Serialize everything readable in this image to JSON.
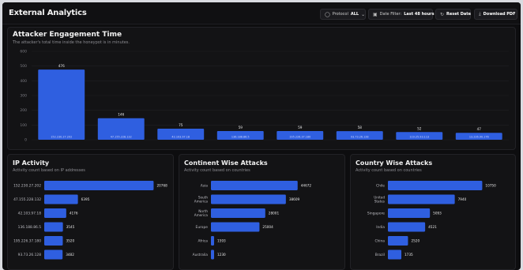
{
  "header": {
    "title": "External Analytics",
    "protocol": {
      "label": "Protocol",
      "value": "ALL"
    },
    "date_filter": {
      "label": "Date Filter:",
      "value": "Last 48 hours"
    },
    "reset_label": "Reset Date",
    "download_label": "Download PDF"
  },
  "engagement": {
    "title": "Attacker Engagement Time",
    "subtitle": "The attacker's total time inside the honeypot is in minutes."
  },
  "ip_activity": {
    "title": "IP Activity",
    "subtitle": "Activity count based on IP addresses"
  },
  "continent": {
    "title": "Continent Wise Attacks",
    "subtitle": "Activity count based on countries"
  },
  "country": {
    "title": "Country Wise Attacks",
    "subtitle": "Activity count based on countries"
  },
  "colors": {
    "bar": "#2f5fe0",
    "background": "#0d0d0f",
    "panel": "#131315"
  },
  "chart_data": [
    {
      "id": "engagement",
      "type": "bar",
      "categories": [
        "152.230.27.202",
        "47.155.228.132",
        "42.103.97.18",
        "136.188.86.5",
        "195.226.37.180",
        "93.73.26.128",
        "119.25.93.113",
        "13.226.90.176"
      ],
      "values": [
        476,
        146,
        75,
        59,
        59,
        58,
        52,
        47
      ],
      "ylim": [
        0,
        600
      ],
      "yticks": [
        0,
        100,
        200,
        300,
        400,
        500,
        600
      ],
      "grid": true
    },
    {
      "id": "ip_activity",
      "type": "bar",
      "orientation": "horizontal",
      "categories": [
        "152.230.27.202",
        "47.155.228.132",
        "42.103.97.18",
        "136.188.86.5",
        "195.226.37.180",
        "93.73.26.128"
      ],
      "values": [
        20768,
        6395,
        4176,
        3545,
        3520,
        3482
      ],
      "xlim": [
        0,
        21000
      ]
    },
    {
      "id": "continent",
      "type": "bar",
      "orientation": "horizontal",
      "categories": [
        "Asia",
        "South America",
        "North America",
        "Europe",
        "Africa",
        "Australia"
      ],
      "values": [
        44672,
        38609,
        28001,
        25004,
        1593,
        1230
      ],
      "xlim": [
        0,
        46000
      ]
    },
    {
      "id": "country",
      "type": "bar",
      "orientation": "horizontal",
      "categories": [
        "Chile",
        "United States",
        "Singapore",
        "India",
        "China",
        "Brazil"
      ],
      "values": [
        12694,
        8996,
        5653,
        5010,
        2706,
        1810
      ],
      "value_labels": [
        "10750",
        "7940",
        "5093",
        "4521",
        "2520",
        "1735"
      ],
      "xlim": [
        0,
        13500
      ]
    }
  ]
}
